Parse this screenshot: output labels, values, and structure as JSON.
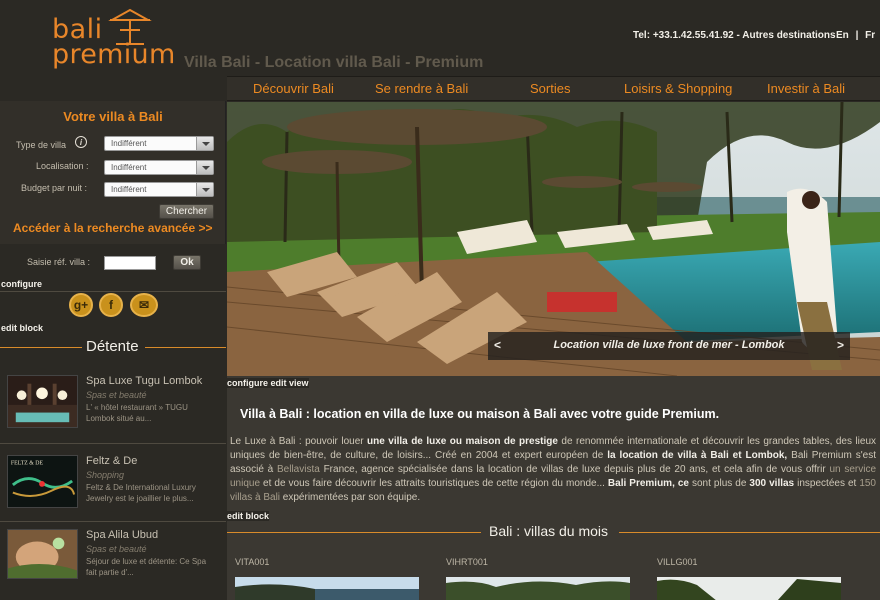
{
  "header": {
    "logo_text_1": "bali",
    "logo_text_2": "premium",
    "site_title": "Villa Bali - Location villa Bali - Premium",
    "phone": "Tel: +33.1.42.55.41.92 - Autres destinations",
    "lang_en": "En",
    "lang_sep": "|",
    "lang_fr": "Fr"
  },
  "nav": {
    "items": [
      "Découvrir Bali",
      "Se rendre à Bali",
      "Sorties",
      "Loisirs & Shopping",
      "Investir à Bali"
    ]
  },
  "search": {
    "title": "Votre villa à Bali",
    "type_label": "Type de villa",
    "type_value": "Indifférent",
    "location_label": "Localisation :",
    "location_value": "Indifférent",
    "budget_label": "Budget par nuit :",
    "budget_value": "Indifférent",
    "search_button": "Chercher",
    "advanced_link": "Accéder à la recherche avancée >>",
    "ref_label": "Saisie réf. villa :",
    "ref_value": "",
    "ok_button": "Ok",
    "configure": "configure",
    "edit_block": "edit block"
  },
  "social": {
    "google": "g+",
    "facebook": "f",
    "mail": "✉"
  },
  "detente": {
    "title": "Détente",
    "items": [
      {
        "name": "Spa Luxe Tugu Lombok",
        "category": "Spas et beauté",
        "desc": "L' « hôtel restaurant » TUGU Lombok situé au..."
      },
      {
        "name": "Feltz & De",
        "category": "Shopping",
        "desc": "Feltz & De International Luxury Jewelry est le joaillier le plus..."
      },
      {
        "name": "Spa Alila Ubud",
        "category": "Spas et beauté",
        "desc": "Séjour de luxe et détente: Ce Spa fait partie d'..."
      }
    ]
  },
  "hero": {
    "caption": "Location villa de luxe front de mer - Lombok",
    "prev": "<",
    "next": ">",
    "configure_edit_view": "configure edit view"
  },
  "intro": {
    "title": "Villa à Bali : location en villa de luxe ou maison à Bali avec votre guide Premium.",
    "p1": "Le Luxe à Bali : pouvoir louer ",
    "b1": "une villa de luxe ou maison de prestige",
    "p2": " de renommée internationale et découvrir les grandes tables, des lieux uniques de bien-être, de culture, de loisirs... Créé en 2004 et expert européen de ",
    "b2": "la location de villa à Bali et Lombok,",
    "p3": " Bali Premium s'est associé à ",
    "l1": "Bellavista",
    "p4": " France, agence spécialisée dans la location de villas de luxe depuis plus de 20 ans, et cela afin de vous offrir ",
    "l2": "un service unique",
    "p5": " et de vous faire découvrir les attraits touristiques de cette région du monde... ",
    "b3": "Bali Premium,",
    "p6": " ",
    "b4": "ce",
    "p7": " sont plus de ",
    "b5": "300 villas",
    "p8": " inspectées et ",
    "l3": "150 villas à Bali",
    "p9": " expérimentées par son équipe.",
    "edit_block": "edit block"
  },
  "villas": {
    "title": "Bali : villas du mois",
    "codes": [
      "VITA001",
      "VIHRT001",
      "VILLG001"
    ]
  },
  "colors": {
    "accent_orange": "#ec8a22",
    "background": "#2b2924",
    "panel": "#3b3832"
  }
}
